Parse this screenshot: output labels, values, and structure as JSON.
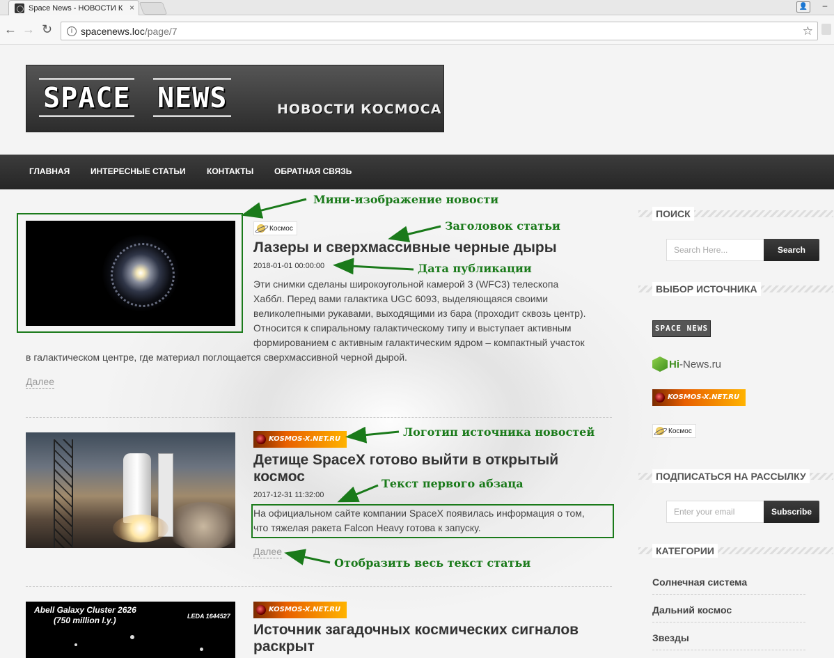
{
  "browser": {
    "tab_title": "Space News - НОВОСТИ К",
    "url_host": "spacenews.loc",
    "url_path": "/page/7"
  },
  "site": {
    "logo_word1": "SPACE",
    "logo_word2": "NEWS",
    "logo_subtitle": "НОВОСТИ КОСМОСА",
    "nav": [
      "ГЛАВНАЯ",
      "ИНТЕРЕСНЫЕ СТАТЬИ",
      "КОНТАКТЫ",
      "ОБРАТНАЯ СВЯЗЬ"
    ]
  },
  "posts": [
    {
      "source": "Космос",
      "title": "Лазеры и сверхмассивные черные дыры",
      "date": "2018-01-01 00:00:00",
      "text_lines": [
        "Эти снимки сделаны широкоугольной камерой 3 (WFC3) телескопа",
        "Хаббл. Перед вами галактика UGC 6093, выделяющаяся своими",
        "великолепными рукавами, выходящими из бара (проходит сквозь центр).",
        "Относится к спиральному галактическому типу и выступает активным",
        "формированием с активным галактическим ядром – компактный участок",
        "в галактическом центре, где материал поглощается сверхмассивной черной дырой."
      ],
      "more": "Далее"
    },
    {
      "source": "KOSMOS-X.NET.RU",
      "title_lines": [
        "Детище SpaceX готово выйти в открытый",
        "космос"
      ],
      "date": "2017-12-31 11:32:00",
      "text_lines": [
        "На официальном сайте компании SpaceX появилась информация о том,",
        "что тяжелая ракета Falcon Heavy готова к запуску."
      ],
      "more": "Далее"
    },
    {
      "source": "KOSMOS-X.NET.RU",
      "title_lines": [
        "Источник загадочных космических сигналов",
        "раскрыт"
      ],
      "thumb_caption_1": "Abell Galaxy Cluster 2626",
      "thumb_caption_2": "(750 million l.y.)",
      "thumb_caption_3": "LEDA 1644527"
    }
  ],
  "sidebar": {
    "search_title": "ПОИСК",
    "search_placeholder": "Search Here...",
    "search_button": "Search",
    "sources_title": "ВЫБОР ИСТОЧНИКА",
    "source_logos": [
      "SPACE NEWS",
      "Hi",
      "-News.ru",
      "KOSMOS-X.NET.RU",
      "Космос"
    ],
    "subscribe_title": "ПОДПИСАТЬСЯ НА РАССЫЛКУ",
    "email_placeholder": "Enter your email",
    "subscribe_button": "Subscribe",
    "categories_title": "КАТЕГОРИИ",
    "categories": [
      "Солнечная система",
      "Дальний космос",
      "Звезды"
    ]
  },
  "annotations": {
    "thumb": "Мини-изображение новости",
    "title": "Заголовок статьи",
    "date": "Дата публикации",
    "source_logo": "Логотип источника новостей",
    "first_paragraph": "Текст первого абзаца",
    "read_more": "Отобразить весь текст статьи",
    "color": "#1a7a1a"
  }
}
